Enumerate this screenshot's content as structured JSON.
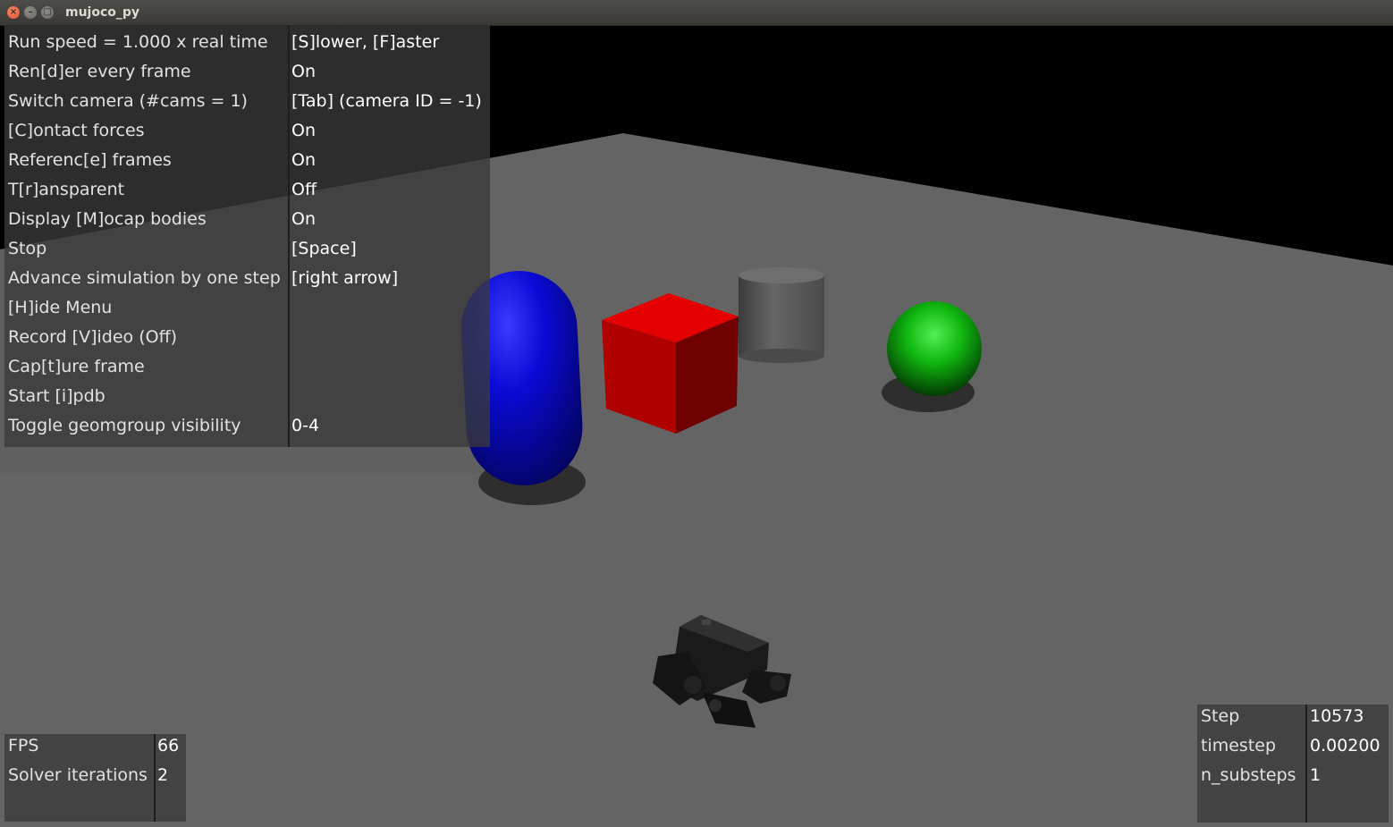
{
  "window": {
    "title": "mujoco_py"
  },
  "menu": {
    "rows": [
      {
        "label": "Run speed = 1.000 x real time",
        "value": "[S]lower, [F]aster"
      },
      {
        "label": "Ren[d]er every frame",
        "value": "On"
      },
      {
        "label": "Switch camera (#cams = 1)",
        "value": "[Tab] (camera ID = -1)"
      },
      {
        "label": "[C]ontact forces",
        "value": "On"
      },
      {
        "label": "Referenc[e] frames",
        "value": "On"
      },
      {
        "label": "T[r]ansparent",
        "value": "Off"
      },
      {
        "label": "Display [M]ocap bodies",
        "value": "On"
      },
      {
        "label": "Stop",
        "value": "[Space]"
      },
      {
        "label": "Advance simulation by one step",
        "value": "[right arrow]"
      },
      {
        "label": "[H]ide Menu",
        "value": ""
      },
      {
        "label": "Record [V]ideo (Off)",
        "value": ""
      },
      {
        "label": "Cap[t]ure frame",
        "value": ""
      },
      {
        "label": "Start [i]pdb",
        "value": ""
      },
      {
        "label": "Toggle geomgroup visibility",
        "value": "0-4"
      }
    ]
  },
  "stats_left": {
    "rows": [
      {
        "label": "FPS",
        "value": "66"
      },
      {
        "label": "Solver iterations",
        "value": "2"
      }
    ]
  },
  "stats_right": {
    "rows": [
      {
        "label": "Step",
        "value": "10573"
      },
      {
        "label": "timestep",
        "value": "0.00200"
      },
      {
        "label": "n_substeps",
        "value": "1"
      }
    ]
  },
  "scene": {
    "objects": [
      "blue-capsule",
      "red-box",
      "gray-cylinder",
      "green-sphere",
      "quadruped-robot"
    ],
    "colors": {
      "floor": "#646464",
      "sky": "#000000",
      "capsule": "#0a0ad0",
      "box": "#d00000",
      "cylinder": "#5a5a5a",
      "sphere": "#10c010"
    }
  }
}
